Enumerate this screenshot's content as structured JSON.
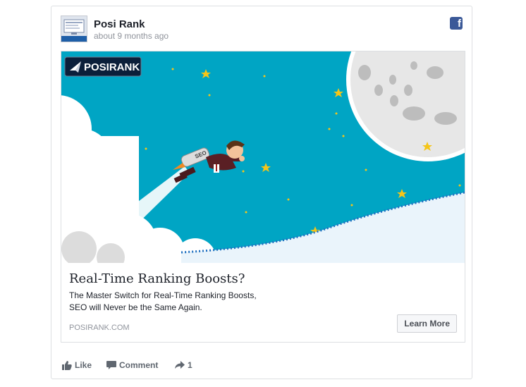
{
  "post": {
    "author": "Posi Rank",
    "time": "about 9 months ago",
    "avatar_icon": "posirank-avatar",
    "network_icon": "facebook-icon",
    "network_glyph": "f"
  },
  "ad": {
    "brand_logo_text": "POSIRANK",
    "jetpack_label": "SEO",
    "title": "Real-Time Ranking Boosts?",
    "description_lines": [
      "The Master Switch for Real-Time Ranking Boosts,",
      "SEO will Never be the Same Again."
    ],
    "domain": "POSIRANK.COM",
    "cta_label": "Learn More"
  },
  "actions": {
    "like_label": "Like",
    "comment_label": "Comment",
    "share_count": "1"
  },
  "colors": {
    "sky": "#00a5c4",
    "facebook_blue": "#3b5998",
    "star": "#f5c518"
  }
}
